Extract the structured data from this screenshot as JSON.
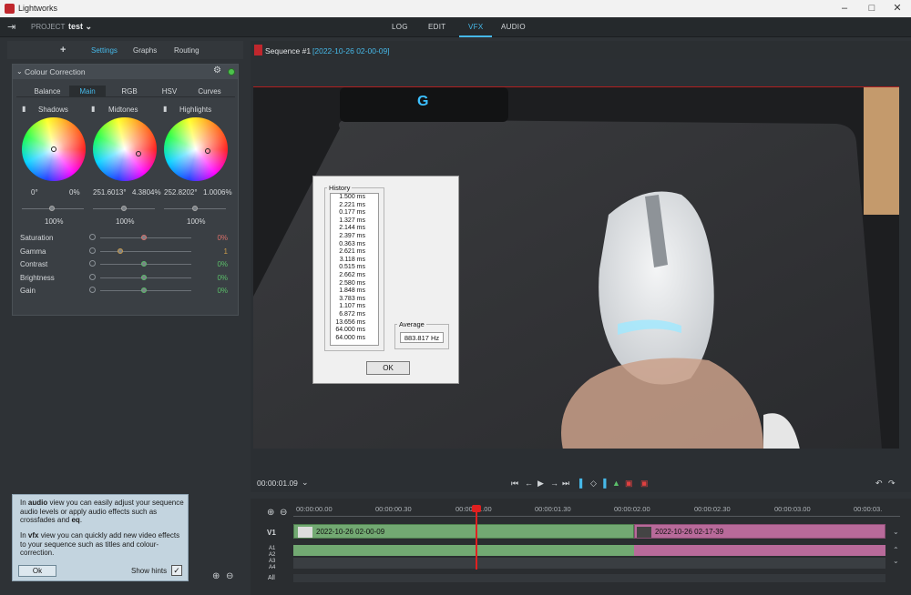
{
  "window": {
    "title": "Lightworks"
  },
  "menubar": {
    "project_label": "PROJECT",
    "project_name": "test",
    "tabs": [
      "LOG",
      "EDIT",
      "VFX",
      "AUDIO"
    ],
    "active_tab": "VFX"
  },
  "left_panel": {
    "tabs": [
      "+",
      "Settings",
      "Graphs",
      "Routing"
    ],
    "effect": {
      "title": "Colour Correction",
      "subtabs": [
        "Balance",
        "Main",
        "RGB",
        "HSV",
        "Curves"
      ],
      "wheels": [
        {
          "name": "Shadows",
          "angle": "0°",
          "amount": "0%",
          "level": "100%"
        },
        {
          "name": "Midtones",
          "angle": "251.6013°",
          "amount": "4.3804%",
          "level": "100%"
        },
        {
          "name": "Highlights",
          "angle": "252.8202°",
          "amount": "1.0006%",
          "level": "100%"
        }
      ],
      "params": [
        {
          "label": "Saturation",
          "value": "0%",
          "knob_color": "#d9706a"
        },
        {
          "label": "Gamma",
          "value": "1",
          "knob_color": "#c99a4a"
        },
        {
          "label": "Contrast",
          "value": "0%",
          "knob_color": "#5bbf6a"
        },
        {
          "label": "Brightness",
          "value": "0%",
          "knob_color": "#5bbf6a"
        },
        {
          "label": "Gain",
          "value": "0%",
          "knob_color": "#5bbf6a"
        }
      ]
    }
  },
  "hint": {
    "para1_pre": "In ",
    "para1_bold": "audio",
    "para1_text": " view you can easily adjust your sequence audio levels or apply audio effects such as crossfades and ",
    "para1_bold2": "eq",
    "para1_end": ".",
    "para2_pre": "In ",
    "para2_bold": "vfx",
    "para2_text": " view you can quickly add new video effects to your sequence such as titles and colour-correction.",
    "ok_label": "Ok",
    "show_hints_label": "Show hints"
  },
  "viewer": {
    "sequence_name": "Sequence #1",
    "sequence_date": "[2022-10-26 02-00-09]",
    "timecode": "00:00:01.09"
  },
  "dialog": {
    "history_label": "History",
    "history": [
      "1.500 ms",
      "2.221 ms",
      "0.177 ms",
      "1.327 ms",
      "2.144 ms",
      "2.397 ms",
      "0.363 ms",
      "2.621 ms",
      "3.118 ms",
      "0.515 ms",
      "2.662 ms",
      "2.580 ms",
      "1.848 ms",
      "3.783 ms",
      "1.107 ms",
      "6.872 ms",
      "13.656 ms",
      "64.000 ms",
      "64.000 ms"
    ],
    "average_label": "Average",
    "average_value": "883.817 Hz",
    "ok_label": "OK"
  },
  "timeline": {
    "ruler": [
      "00:00:00.00",
      "00:00:00.30",
      "00:00:01.00",
      "00:00:01.30",
      "00:00:02.00",
      "00:00:02.30",
      "00:00:03.00",
      "00:00:03."
    ],
    "tracks": [
      "V1",
      "A1",
      "A2",
      "A3",
      "A4",
      "All"
    ],
    "clips": [
      {
        "label": "2022-10-26 02-00-09"
      },
      {
        "label": "2022-10-26 02-17-39"
      }
    ]
  }
}
